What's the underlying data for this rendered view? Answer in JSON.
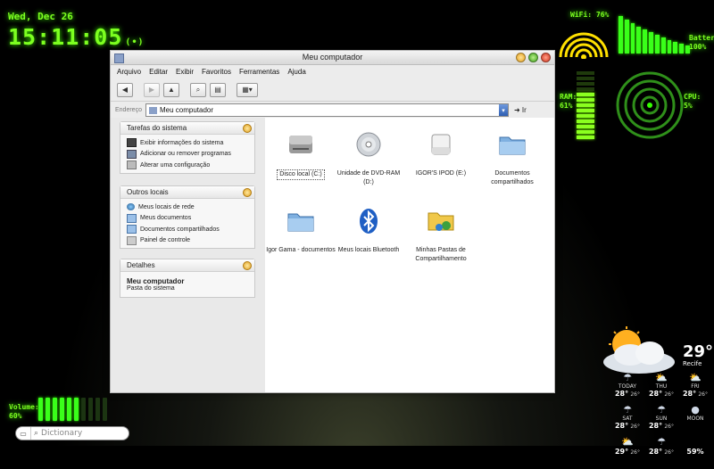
{
  "desktop": {
    "clock": {
      "date": "Wed, Dec 26",
      "time": "15:11:05",
      "alarm_icon": "(•)"
    },
    "wifi": {
      "label": "WiFi: 76%"
    },
    "battery": {
      "label_line1": "Battery:",
      "label_line2": "100%",
      "level": 1.0
    },
    "ram": {
      "label_line1": "RAM:",
      "label_line2": "61%",
      "level": 0.61
    },
    "cpu": {
      "label_line1": "CPU:",
      "label_line2": "5%",
      "level": 0.05
    },
    "volume": {
      "label_line1": "Volume:",
      "label_line2": "60%",
      "level": 0.6
    },
    "dictionary": {
      "placeholder": "Dictionary"
    },
    "weather": {
      "temp": "29°",
      "city": "Recife",
      "forecast": [
        {
          "day": "TODAY",
          "hi": "28°",
          "lo": "26°",
          "icon": "cloud-rain-icon"
        },
        {
          "day": "THU",
          "hi": "28°",
          "lo": "26°",
          "icon": "partly-sunny-icon"
        },
        {
          "day": "FRI",
          "hi": "28°",
          "lo": "26°",
          "icon": "partly-sunny-icon"
        },
        {
          "day": "SAT",
          "hi": "28°",
          "lo": "26°",
          "icon": "cloud-rain-icon"
        },
        {
          "day": "SUN",
          "hi": "28°",
          "lo": "26°",
          "icon": "cloud-rain-icon"
        },
        {
          "day": "MOON",
          "hi": "",
          "lo": "",
          "icon": "moon-icon"
        },
        {
          "day": "",
          "hi": "29°",
          "lo": "26°",
          "icon": "partly-sunny-icon"
        },
        {
          "day": "",
          "hi": "28°",
          "lo": "26°",
          "icon": "cloud-rain-icon"
        },
        {
          "day": "",
          "hi": "59%",
          "lo": "",
          "icon": ""
        }
      ]
    }
  },
  "window": {
    "title": "Meu computador",
    "menu": [
      "Arquivo",
      "Editar",
      "Exibir",
      "Favoritos",
      "Ferramentas",
      "Ajuda"
    ],
    "address": {
      "label": "Endereço",
      "value": "Meu computador",
      "go": "Ir"
    },
    "tasks_panel": {
      "title": "Tarefas do sistema",
      "items": [
        "Exibir informações do sistema",
        "Adicionar ou remover programas",
        "Alterar uma configuração"
      ]
    },
    "places_panel": {
      "title": "Outros locais",
      "items": [
        "Meus locais de rede",
        "Meus documentos",
        "Documentos compartilhados",
        "Painel de controle"
      ]
    },
    "details_panel": {
      "title": "Detalhes",
      "name": "Meu computador",
      "sub": "Pasta do sistema"
    },
    "files": [
      {
        "label": "Disco local (C:)",
        "icon": "hard-disk-icon",
        "selected": true
      },
      {
        "label": "Unidade de DVD-RAM (D:)",
        "icon": "dvd-drive-icon",
        "selected": false
      },
      {
        "label": "IGOR'S IPOD (E:)",
        "icon": "ipod-drive-icon",
        "selected": false
      },
      {
        "label": "Documentos compartilhados",
        "icon": "shared-folder-icon",
        "selected": false
      },
      {
        "label": "Igor Gama - documentos",
        "icon": "folder-icon",
        "selected": false
      },
      {
        "label": "Meus locais Bluetooth",
        "icon": "bluetooth-icon",
        "selected": false
      },
      {
        "label": "Minhas Pastas de Compartilhamento",
        "icon": "share-folder-icon",
        "selected": false
      }
    ]
  }
}
